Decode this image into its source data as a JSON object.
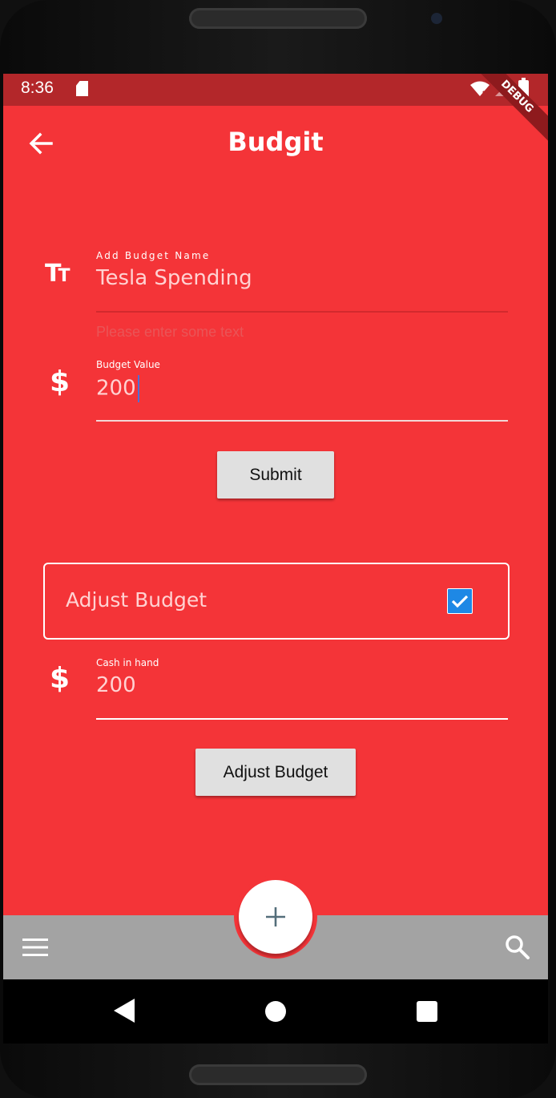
{
  "status_bar": {
    "time": "8:36",
    "debug_banner": "DEBUG"
  },
  "app_bar": {
    "title": "Budgit"
  },
  "budget_name_field": {
    "label": "Add Budget Name",
    "value": "Tesla Spending",
    "helper_text": "Please enter some text"
  },
  "budget_value_field": {
    "label": "Budget Value",
    "value": "200"
  },
  "submit_button": {
    "label": "Submit"
  },
  "adjust_budget_card": {
    "label": "Adjust Budget",
    "checked": true
  },
  "cash_in_hand_field": {
    "label": "Cash in hand",
    "value": "200"
  },
  "adjust_budget_button": {
    "label": "Adjust Budget"
  },
  "colors": {
    "primary": "#F43438",
    "status_bar": "#B3272A",
    "bottom_bar": "#A3A3A3",
    "checkbox": "#1E88E5"
  }
}
